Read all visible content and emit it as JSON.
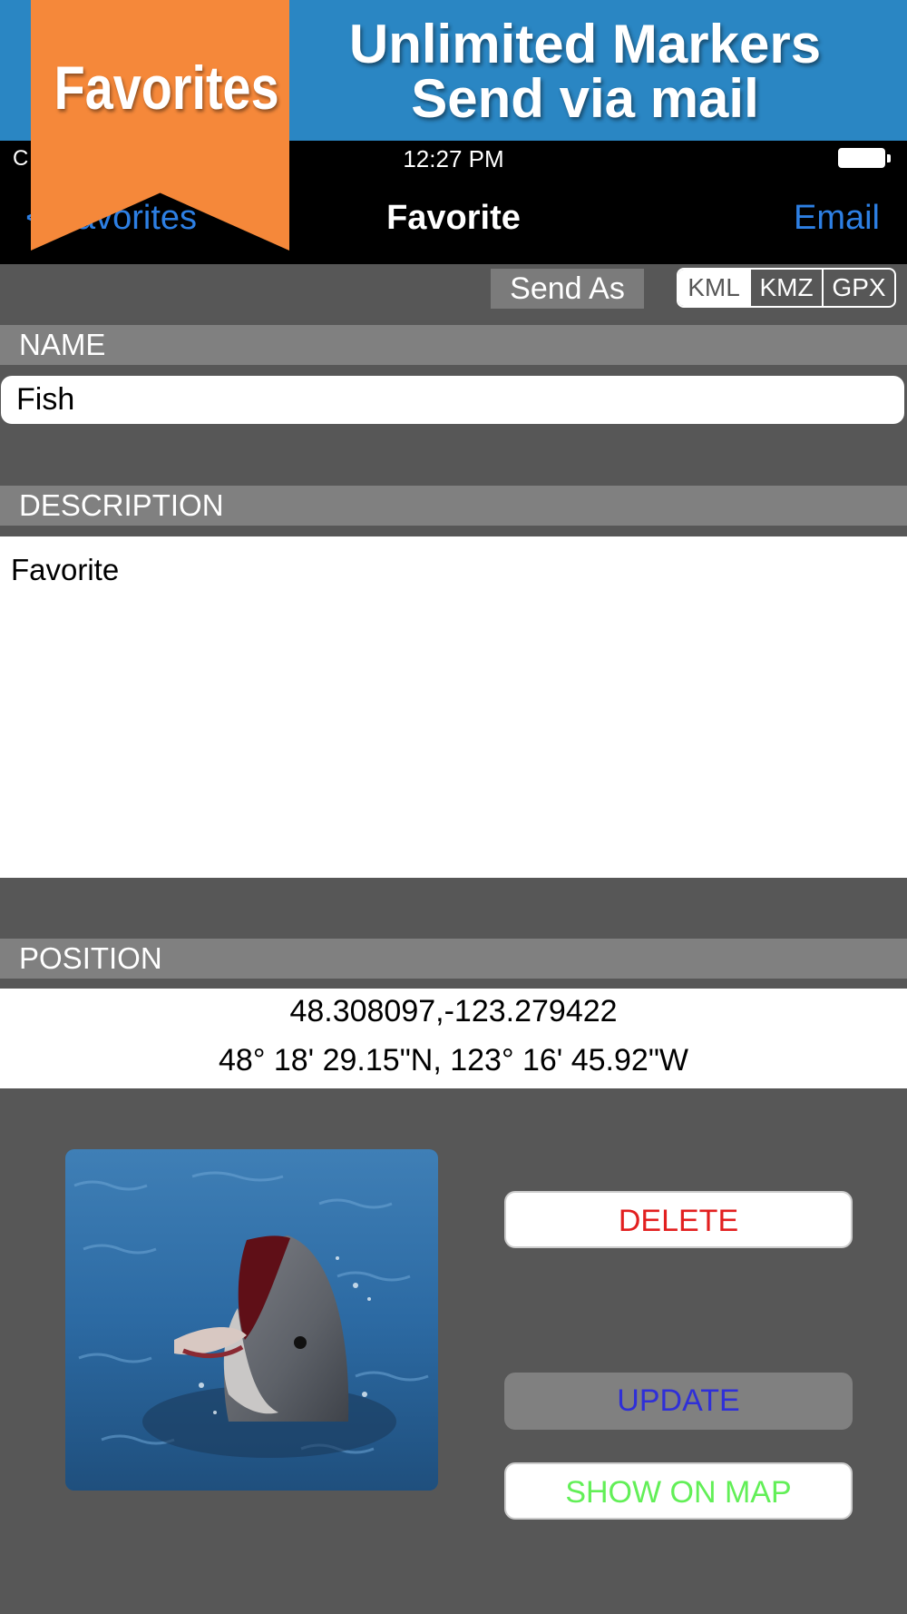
{
  "promo": {
    "line1": "Unlimited Markers",
    "line2": "Send via mail",
    "ribbon": "Favorites"
  },
  "status_bar": {
    "carrier": "C",
    "time": "12:27 PM"
  },
  "nav": {
    "back_label": "< Favorites",
    "title": "Favorite",
    "right_label": "Email"
  },
  "send_as": {
    "label": "Send As",
    "options": [
      "KML",
      "KMZ",
      "GPX"
    ],
    "selected": "KML"
  },
  "sections": {
    "name_header": "NAME",
    "description_header": "DESCRIPTION",
    "position_header": "POSITION"
  },
  "fields": {
    "name_value": "Fish",
    "description_value": "Favorite"
  },
  "position": {
    "decimal": "48.308097,-123.279422",
    "dms": "48° 18' 29.15\"N, 123° 16' 45.92\"W"
  },
  "actions": {
    "delete": "DELETE",
    "update": "UPDATE",
    "show_on_map": "SHOW ON MAP"
  },
  "colors": {
    "promo_blue": "#2a86c3",
    "ribbon_orange": "#f5883a",
    "link_blue": "#2d7fe3",
    "delete_red": "#e21f1f",
    "update_blue": "#2f2fd8",
    "show_green": "#62ef57",
    "background_gray": "#575757"
  },
  "icons": {
    "battery": "battery-icon",
    "photo": "dolphin-photo"
  }
}
